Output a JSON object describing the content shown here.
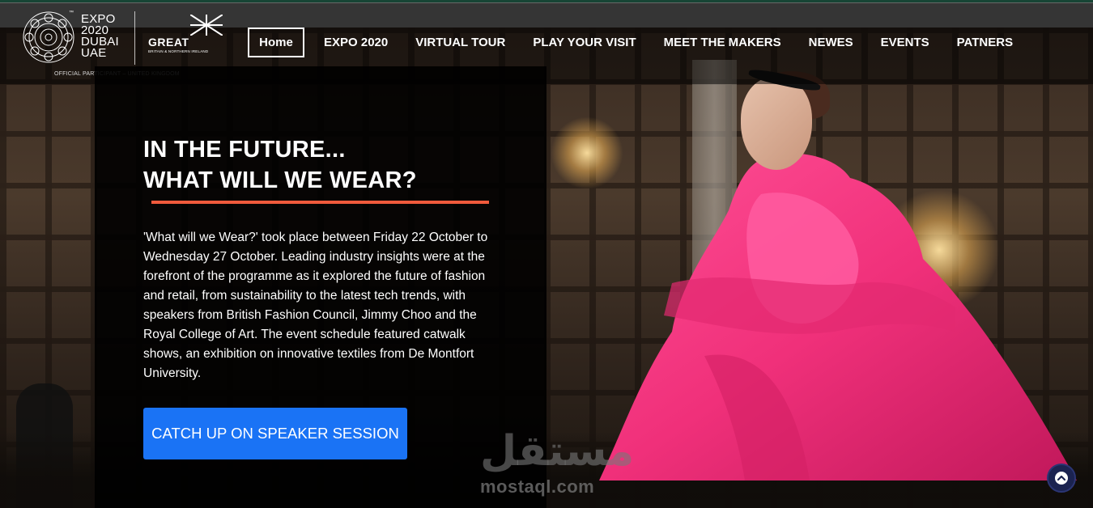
{
  "brand": {
    "expo_lines": [
      "EXPO",
      "2020",
      "DUBAI",
      "UAE"
    ],
    "expo_tm": "™",
    "great_label": "GREAT",
    "great_subtitle": "BRITAIN & NORTHERN IRELAND",
    "official_label": "OFFICIAL PARTICIPANT – UNITED KINGDOM"
  },
  "nav": {
    "items": [
      {
        "label": "Home",
        "active": true
      },
      {
        "label": "EXPO 2020",
        "active": false
      },
      {
        "label": "VIRTUAL TOUR",
        "active": false
      },
      {
        "label": "PLAY YOUR VISIT",
        "active": false
      },
      {
        "label": "MEET THE MAKERS",
        "active": false
      },
      {
        "label": "NEWES",
        "active": false
      },
      {
        "label": "EVENTS",
        "active": false
      },
      {
        "label": "PATNERS",
        "active": false
      }
    ]
  },
  "hero": {
    "headline_line1": "IN THE FUTURE...",
    "headline_line2": "WHAT WILL WE WEAR?",
    "body": "'What will we Wear?' took place between Friday 22 October to Wednesday 27 October. Leading industry insights were at the forefront of the programme as it explored the future of fashion and retail, from sustainability to the latest tech trends, with speakers from British Fashion Council, Jimmy Choo and the Royal College of Art. The event schedule featured catwalk shows, an exhibition on innovative textiles from De Montfort University.",
    "cta_label": "CATCH UP ON SPEAKER SESSION"
  },
  "watermark": {
    "arabic": "مستقل",
    "latin": "mostaql.com"
  },
  "icons": {
    "scroll_top": "chevron-up-icon",
    "expo_logo": "expo-rosette-icon",
    "union_flag": "union-flag-icon"
  },
  "colors": {
    "accent_underline": "#f05a3c",
    "cta_blue": "#1a73f5",
    "dress_pink": "#f0307a",
    "scroll_button": "#1b2350"
  }
}
